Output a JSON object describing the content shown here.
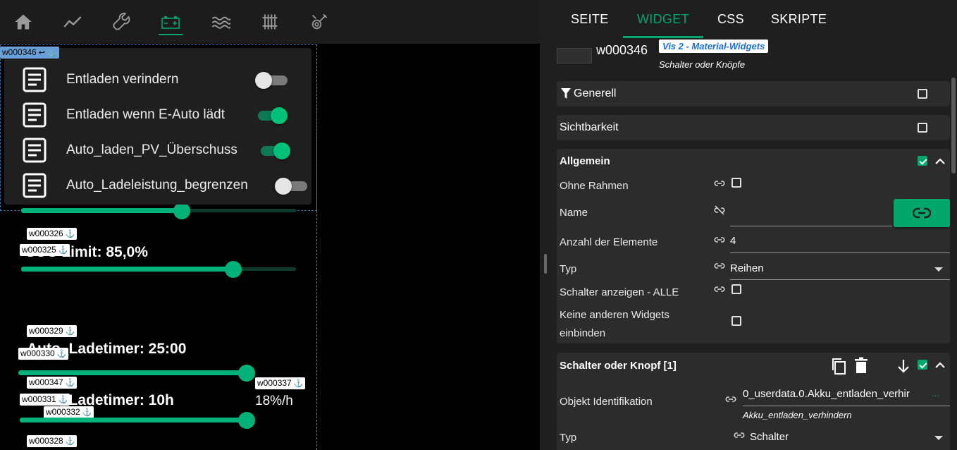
{
  "nav": {
    "icons": [
      "home-icon",
      "chart-line-icon",
      "wrench-icon",
      "battery-icon",
      "waves-icon",
      "radiator-icon",
      "tools-icon"
    ],
    "active_index": 3,
    "accent": "#00a66a"
  },
  "canvas": {
    "selected_widget": "w000346",
    "switches": [
      {
        "label": "Entladen verindern",
        "state": false
      },
      {
        "label": "Entladen wenn E-Auto lädt",
        "state": true
      },
      {
        "label": "Auto_laden_PV_Überschuss",
        "state": true
      },
      {
        "label": "Auto_Ladeleistung_begrenzen",
        "state": false
      }
    ],
    "tags": {
      "t326": "w000326",
      "t325": "w000325",
      "t329": "w000329",
      "t330": "w000330",
      "t347": "w000347",
      "t337": "w000337",
      "t331": "w000331",
      "t332": "w000332",
      "t328": "w000328"
    },
    "texts": {
      "soc_limit": "SOC Limit: 85,0%",
      "ladetimer": "Auto_Ladetimer: 25:00",
      "ladetimer2": "Auto_Ladetimer: 10h",
      "rate": "18%/h"
    },
    "sliders": {
      "soc_limit_fraction": 0.79,
      "ladetimer_fraction": 1.0,
      "ladetimer2_fraction": 1.0,
      "top_fraction": 0.59
    }
  },
  "panel": {
    "tabs": [
      "SEITE",
      "WIDGET",
      "CSS",
      "SKRIPTE"
    ],
    "active_tab": "WIDGET",
    "widget": {
      "id": "w000346",
      "set": "Vis 2 - Material-Widgets",
      "type": "Schalter oder Knöpfe"
    },
    "sections": {
      "generell": "Generell",
      "sichtbarkeit": "Sichtbarkeit",
      "allgemein": "Allgemein",
      "schalter": "Schalter oder Knopf [1]"
    },
    "props": {
      "ohne_rahmen": "Ohne Rahmen",
      "name": "Name",
      "anzahl": "Anzahl der Elemente",
      "anzahl_val": "4",
      "typ": "Typ",
      "typ_val": "Reihen",
      "schalter_alle": "Schalter anzeigen - ALLE",
      "keine_1": "Keine anderen Widgets",
      "keine_2": "einbinden",
      "objekt_id": "Objekt Identifikation",
      "objekt_val": "0_userdata.0.Akku_entladen_verhir",
      "objekt_dots": "...",
      "objekt_name": "Akku_entladen_verhindern",
      "typ2": "Typ",
      "typ2_val": "Schalter"
    }
  }
}
